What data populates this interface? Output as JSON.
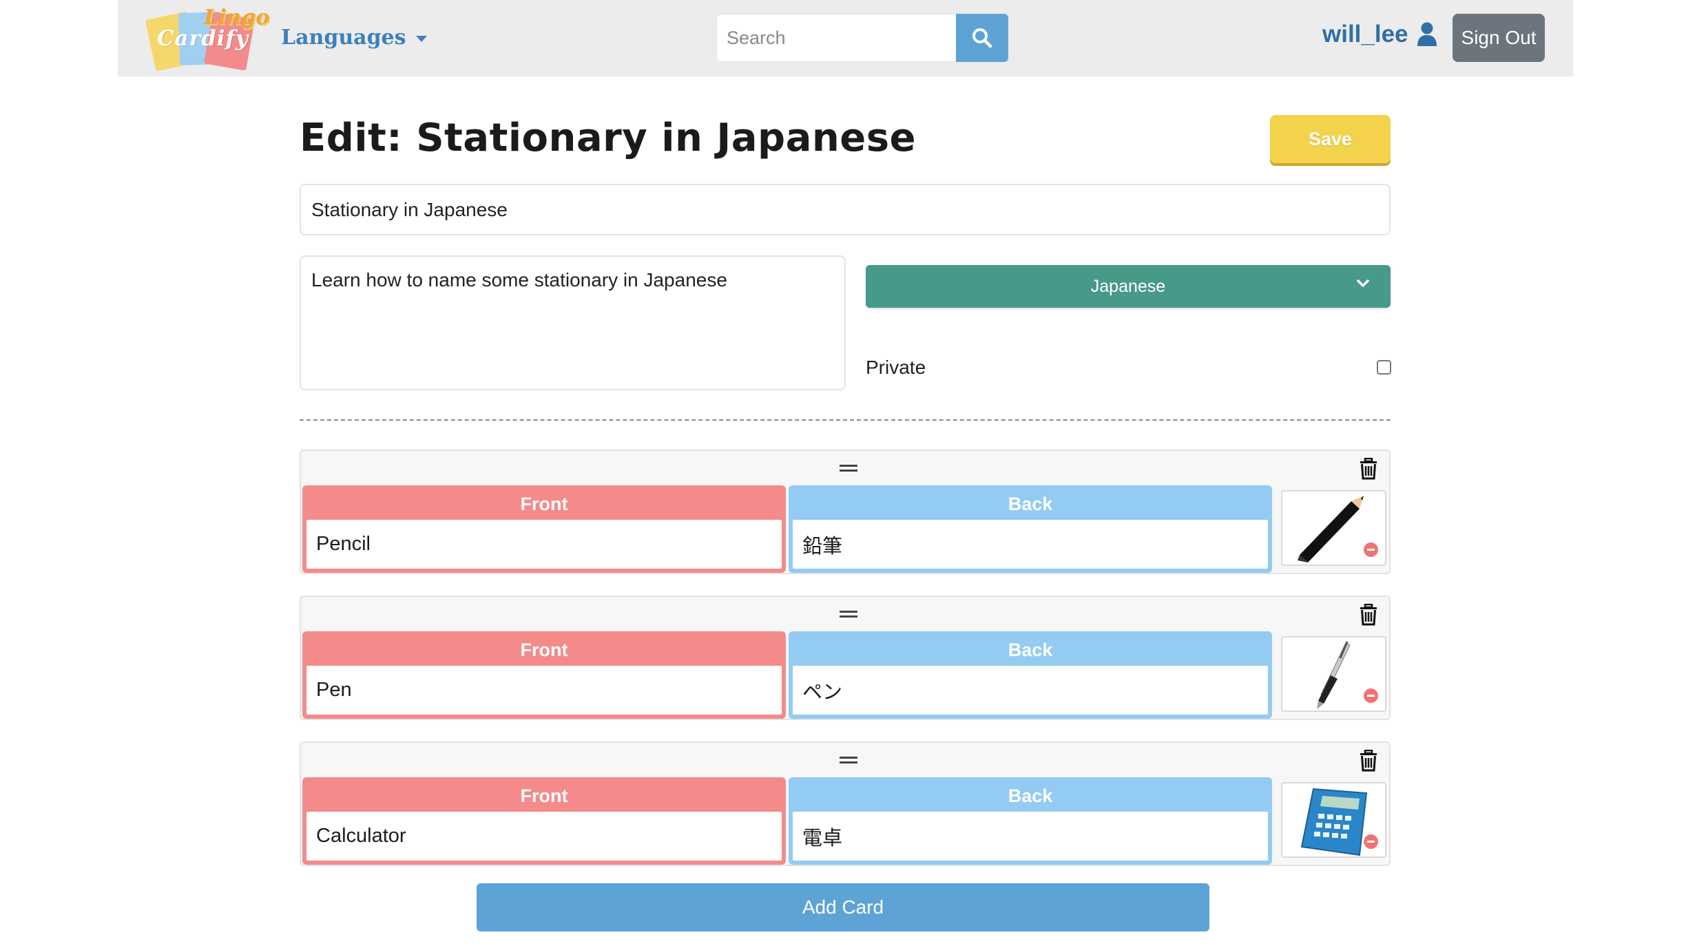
{
  "app": {
    "logo_text_main": "Cardify",
    "logo_text_accent": "Lingo"
  },
  "navbar": {
    "languages_label": "Languages",
    "search_placeholder": "Search",
    "username": "will_lee",
    "signout_label": "Sign Out"
  },
  "page": {
    "title": "Edit: Stationary in Japanese",
    "save_label": "Save",
    "deck_name": "Stationary in Japanese",
    "description": "Learn how to name some stationary in Japanese",
    "language_selected": "Japanese",
    "private_label": "Private",
    "private_checked": false,
    "add_card_label": "Add Card"
  },
  "cards": [
    {
      "front_label": "Front",
      "back_label": "Back",
      "front": "Pencil",
      "back": "鉛筆",
      "image_icon": "pencil-image"
    },
    {
      "front_label": "Front",
      "back_label": "Back",
      "front": "Pen",
      "back": "ペン",
      "image_icon": "pen-image"
    },
    {
      "front_label": "Front",
      "back_label": "Back",
      "front": "Calculator",
      "back": "電卓",
      "image_icon": "calculator-image"
    }
  ],
  "colors": {
    "navbar_bg": "#ececec",
    "brand_blue": "#3d7fbf",
    "search_button": "#5ea3d6",
    "save_button": "#f2d34b",
    "language_select": "#479a8a",
    "front_side": "#f58a8a",
    "back_side": "#93cbf2",
    "signout_button": "#6c757d"
  }
}
